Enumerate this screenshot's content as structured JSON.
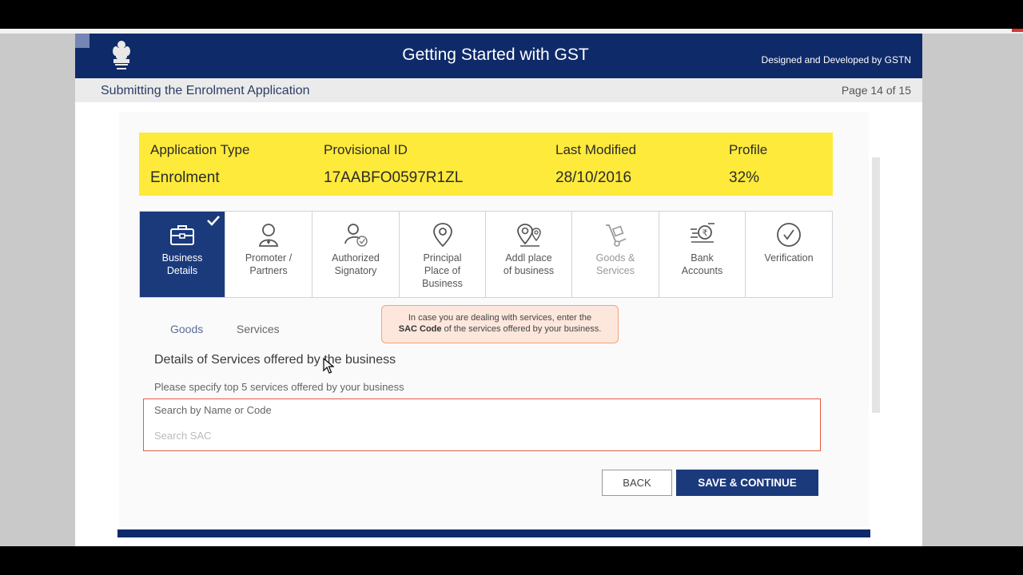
{
  "header": {
    "title": "Getting Started with GST",
    "credit": "Designed and Developed by GSTN"
  },
  "subbar": {
    "title": "Submitting the Enrolment Application",
    "page_indicator": "Page 14 of 15"
  },
  "info": {
    "application_type_label": "Application Type",
    "application_type_value": "Enrolment",
    "provisional_id_label": "Provisional ID",
    "provisional_id_value": "17AABFO0597R1ZL",
    "last_modified_label": "Last Modified",
    "last_modified_value": "28/10/2016",
    "profile_label": "Profile",
    "profile_value": "32%"
  },
  "tabs": [
    {
      "label_1": "Business",
      "label_2": "Details",
      "label_3": "",
      "icon": "briefcase-icon",
      "state": "active-completed"
    },
    {
      "label_1": "Promoter /",
      "label_2": "Partners",
      "label_3": "",
      "icon": "person-icon",
      "state": "normal"
    },
    {
      "label_1": "Authorized",
      "label_2": "Signatory",
      "label_3": "",
      "icon": "person-check-icon",
      "state": "normal"
    },
    {
      "label_1": "Principal",
      "label_2": "Place of",
      "label_3": "Business",
      "icon": "location-pin-icon",
      "state": "normal"
    },
    {
      "label_1": "Addl place",
      "label_2": "of business",
      "label_3": "",
      "icon": "multi-location-icon",
      "state": "normal"
    },
    {
      "label_1": "Goods &",
      "label_2": "Services",
      "label_3": "",
      "icon": "hand-truck-icon",
      "state": "dim"
    },
    {
      "label_1": "Bank",
      "label_2": "Accounts",
      "label_3": "",
      "icon": "rupee-coin-icon",
      "state": "normal"
    },
    {
      "label_1": "Verification",
      "label_2": "",
      "label_3": "",
      "icon": "check-circle-icon",
      "state": "normal"
    }
  ],
  "subtabs": {
    "goods": "Goods",
    "services": "Services"
  },
  "tooltip": {
    "line1": "In case you are dealing with services, enter the",
    "bold": "SAC Code",
    "line2_rest": " of the services offered by your business."
  },
  "section": {
    "heading": "Details of Services offered by the business",
    "instruction": "Please specify top 5 services offered by your business"
  },
  "search": {
    "label": "Search by Name or Code",
    "placeholder": "Search SAC",
    "value": ""
  },
  "buttons": {
    "back": "BACK",
    "save": "SAVE & CONTINUE"
  },
  "colors": {
    "header_navy": "#0e2a69",
    "info_yellow": "#fdea3b",
    "active_tab": "#1b3a7c",
    "search_border": "#e55a44",
    "tooltip_bg": "#fde7dc"
  }
}
